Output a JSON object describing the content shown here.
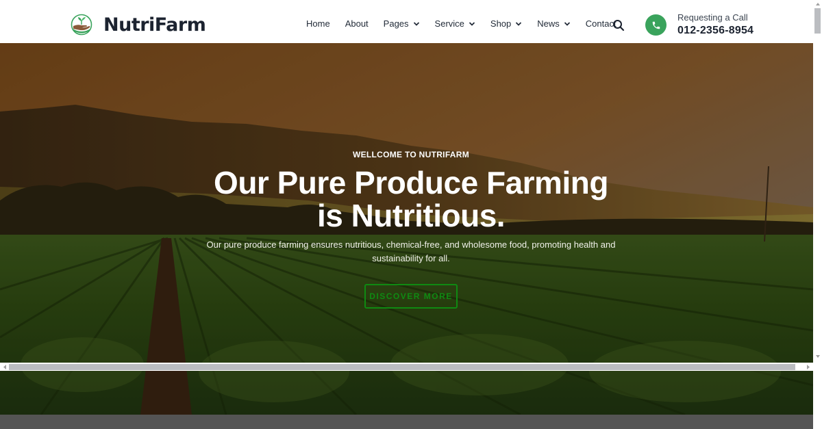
{
  "brand": {
    "name": "NutriFarm",
    "logo_icon": "hand-sprout-logo-icon"
  },
  "nav": {
    "items": [
      {
        "label": "Home",
        "has_dropdown": false
      },
      {
        "label": "About",
        "has_dropdown": false
      },
      {
        "label": "Pages",
        "has_dropdown": true
      },
      {
        "label": "Service",
        "has_dropdown": true
      },
      {
        "label": "Shop",
        "has_dropdown": true
      },
      {
        "label": "News",
        "has_dropdown": true
      },
      {
        "label": "Contact",
        "has_dropdown": false
      }
    ],
    "search_icon": "search-icon"
  },
  "call": {
    "icon": "phone-icon",
    "label": "Requesting a Call",
    "number": "012-2356-8954"
  },
  "hero": {
    "kicker": "WELLCOME TO NUTRIFARM",
    "headline_line1": "Our Pure Produce Farming",
    "headline_line2": "is Nutritious.",
    "subtext": "Our pure produce farming ensures nutritious, chemical-free, and wholesome food, promoting health and sustainability for all.",
    "cta_label": "DISCOVER MORE",
    "background": "farm field with lettuce rows and hills at sunset"
  },
  "colors": {
    "accent_green": "#3aa35c",
    "cta_green": "#0f8a12",
    "text_dark": "#1c2330",
    "footer_band": "#545454"
  }
}
